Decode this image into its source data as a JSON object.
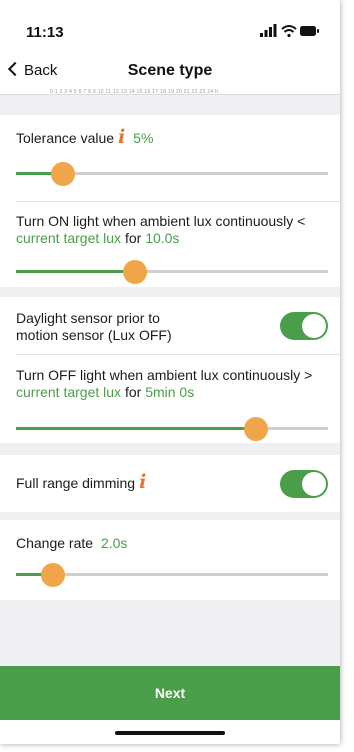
{
  "status_bar": {
    "time": "11:13"
  },
  "nav": {
    "back_label": "Back",
    "title": "Scene type"
  },
  "tick_scale": "0 1 2 3 4 5 6 7 8 9 10 11 12 13 14 15 16 17 18 19 20 21 22 23 24 h",
  "tolerance": {
    "label": "Tolerance value",
    "value": "5%",
    "slider_level": 0.15
  },
  "turn_on": {
    "text": "Turn ON light when ambient lux continuously <",
    "link": "current target lux",
    "for_label": "for",
    "duration": "10.0s",
    "slider_level": 0.38
  },
  "daylight_sensor": {
    "line1": "Daylight sensor prior to",
    "line2": "motion sensor (Lux OFF)",
    "enabled": true
  },
  "turn_off": {
    "text": "Turn OFF light when ambient lux continuously >",
    "link": "current target lux",
    "for_label": "for",
    "duration": "5min 0s",
    "slider_level": 0.77
  },
  "full_range_dimming": {
    "label": "Full range dimming",
    "enabled": true
  },
  "change_rate": {
    "label": "Change rate",
    "value": "2.0s",
    "slider_level": 0.12
  },
  "next_button": {
    "label": "Next"
  },
  "colors": {
    "accent": "#4a9e4a",
    "thumb": "#f0a548",
    "info_icon": "#e8742c"
  },
  "icons": {
    "cellular": "cellular-signal-icon",
    "wifi": "wifi-icon",
    "battery": "battery-icon",
    "info": "info-icon",
    "back": "chevron-left-icon"
  }
}
